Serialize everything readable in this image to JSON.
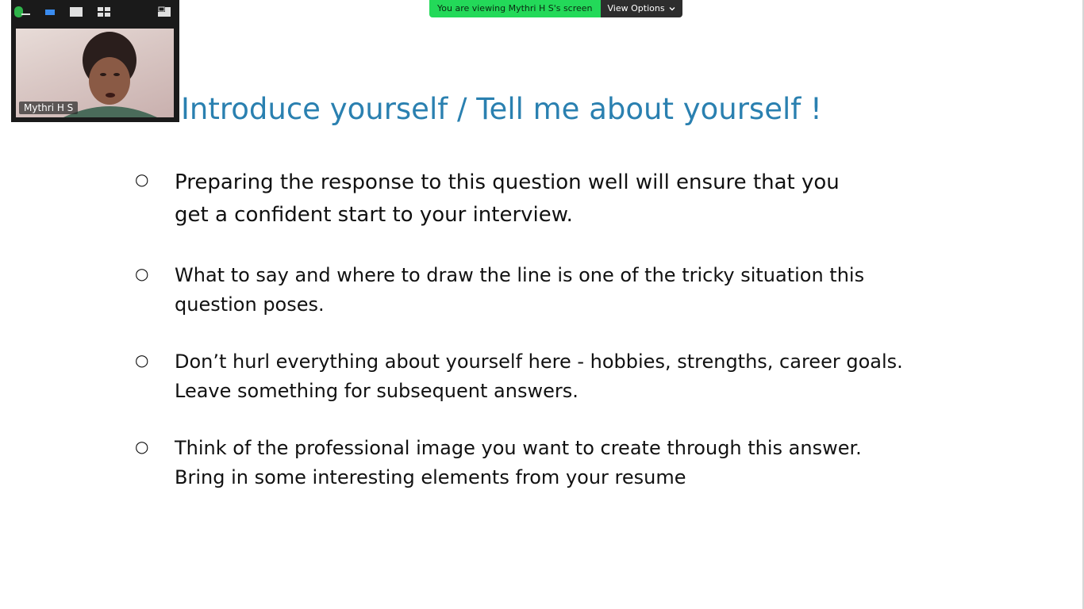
{
  "banner": {
    "status_text": "You are viewing Mythri H S's screen",
    "view_options_label": "View Options",
    "view_options_icon": "chevron-down-icon",
    "status_color": "#23d959"
  },
  "video_panel": {
    "toolbar": {
      "minimize_icon": "minimize-icon",
      "active_speaker_icon": "active-speaker-view-icon",
      "speaker_view_icon": "speaker-view-icon",
      "gallery_icon": "gallery-view-icon",
      "exit_icon": "exit-minimized-icon"
    },
    "participant_name": "Mythri H S"
  },
  "slide": {
    "title": "Introduce yourself / Tell me about yourself !",
    "title_color": "#2a80b0",
    "bullet_marker": "○",
    "bullets": [
      {
        "line1": "Preparing the response to this question well will ensure that you",
        "line2": "get a confident start to your interview."
      },
      {
        "line1": "What to say and where to draw the line is one of the tricky situation this",
        "line2": "question poses."
      },
      {
        "line1": "Don’t hurl everything about yourself here - hobbies, strengths, career goals.",
        "line2": "Leave something for subsequent answers."
      },
      {
        "line1": "Think of the professional image you want to create through this answer.",
        "line2": "Bring in some interesting elements from your resume"
      }
    ]
  }
}
